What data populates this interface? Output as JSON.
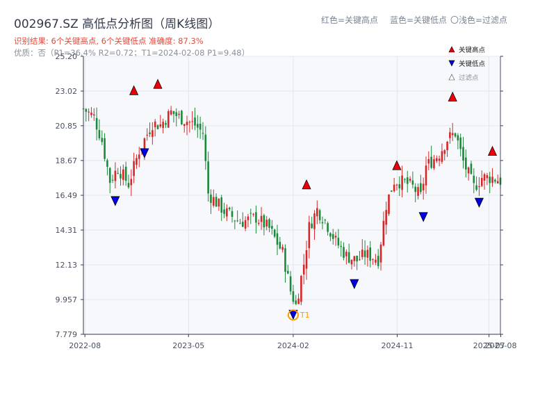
{
  "header": {
    "title": "002967.SZ 高低点分析图（周K线图）",
    "color_note": {
      "red": "红色=关键高点",
      "blue": "蓝色=关键低点",
      "light": "〇浅色=过滤点"
    },
    "result_line": "识别结果: 6个关键高点, 6个关键低点  准确度: 87.3%",
    "quality_line": "优质：否（P1=36.4%  R2=0.72；T1=2024-02-08 P1=9.48）"
  },
  "legend": {
    "high_label": "关键高点",
    "low_label": "关键低点",
    "filtered_label": "过滤点"
  },
  "colors": {
    "up": "#d62728",
    "down": "#1a8a3a",
    "high_marker": "#e8000b",
    "low_marker": "#0000e0",
    "t1": "#ff9900",
    "plot_bg": "#f6f8fb",
    "grid": "#dde2ea"
  },
  "chart_data": {
    "type": "candlestick",
    "title": "002967.SZ 高低点分析图（周K线图）",
    "xlabel": "",
    "ylabel": "",
    "x_range": [
      "2022-07-28",
      "2025-07-31"
    ],
    "ylim": [
      7.779,
      25.2
    ],
    "y_ticks": [
      "25.20",
      "23.02",
      "20.85",
      "18.67",
      "16.49",
      "14.31",
      "12.13",
      "9.957",
      "7.779"
    ],
    "x_ticks": [
      {
        "label": "2022-08",
        "date": "2022-08-01"
      },
      {
        "label": "2023-05",
        "date": "2023-05-01"
      },
      {
        "label": "2024-02",
        "date": "2024-02-01"
      },
      {
        "label": "2024-11",
        "date": "2024-11-01"
      },
      {
        "label": "2025-07",
        "date": "2025-07-01"
      },
      {
        "label": "2025-08",
        "date": "2025-08-01"
      }
    ],
    "grid": true,
    "legend_position": "top-right",
    "close_anchors": [
      [
        "2022-07-28",
        21.9
      ],
      [
        "2022-08-25",
        21.4
      ],
      [
        "2022-09-15",
        19.9
      ],
      [
        "2022-10-06",
        17.4
      ],
      [
        "2022-10-27",
        18.2
      ],
      [
        "2022-11-24",
        17.2
      ],
      [
        "2022-12-22",
        19.3
      ],
      [
        "2023-01-26",
        21.0
      ],
      [
        "2023-02-16",
        20.9
      ],
      [
        "2023-03-16",
        21.7
      ],
      [
        "2023-04-06",
        21.4
      ],
      [
        "2023-05-18",
        20.9
      ],
      [
        "2023-06-08",
        20.4
      ],
      [
        "2023-06-22",
        16.6
      ],
      [
        "2023-08-03",
        15.5
      ],
      [
        "2023-09-14",
        14.8
      ],
      [
        "2023-10-26",
        15.1
      ],
      [
        "2023-11-30",
        14.4
      ],
      [
        "2024-01-04",
        12.9
      ],
      [
        "2024-01-25",
        10.5
      ],
      [
        "2024-02-08",
        9.6
      ],
      [
        "2024-02-29",
        12.2
      ],
      [
        "2024-03-14",
        14.5
      ],
      [
        "2024-04-04",
        15.6
      ],
      [
        "2024-04-25",
        14.9
      ],
      [
        "2024-05-23",
        13.6
      ],
      [
        "2024-06-20",
        12.7
      ],
      [
        "2024-07-18",
        12.4
      ],
      [
        "2024-08-08",
        12.8
      ],
      [
        "2024-09-12",
        12.5
      ],
      [
        "2024-10-03",
        15.9
      ],
      [
        "2024-10-24",
        17.4
      ],
      [
        "2024-11-21",
        17.3
      ],
      [
        "2024-12-12",
        17.0
      ],
      [
        "2025-01-02",
        16.4
      ],
      [
        "2025-01-16",
        18.3
      ],
      [
        "2025-02-20",
        19.1
      ],
      [
        "2025-03-13",
        20.0
      ],
      [
        "2025-04-03",
        20.4
      ],
      [
        "2025-04-24",
        18.6
      ],
      [
        "2025-05-22",
        17.0
      ],
      [
        "2025-06-12",
        17.6
      ],
      [
        "2025-07-10",
        17.6
      ],
      [
        "2025-07-31",
        17.4
      ]
    ],
    "key_highs": [
      {
        "date": "2022-12-08",
        "value": 22.7
      },
      {
        "date": "2023-02-09",
        "value": 23.1
      },
      {
        "date": "2024-03-07",
        "value": 16.8
      },
      {
        "date": "2024-10-31",
        "value": 18.0
      },
      {
        "date": "2025-03-27",
        "value": 22.3
      },
      {
        "date": "2025-07-10",
        "value": 18.9
      }
    ],
    "key_lows": [
      {
        "date": "2022-10-20",
        "value": 16.5
      },
      {
        "date": "2023-01-05",
        "value": 19.5
      },
      {
        "date": "2024-02-01",
        "value": 9.38
      },
      {
        "date": "2024-07-11",
        "value": 11.3
      },
      {
        "date": "2025-01-09",
        "value": 15.5
      },
      {
        "date": "2025-06-05",
        "value": 16.4
      }
    ],
    "t1": {
      "label": "T1",
      "date": "2024-02-01",
      "value": 9.38
    }
  }
}
